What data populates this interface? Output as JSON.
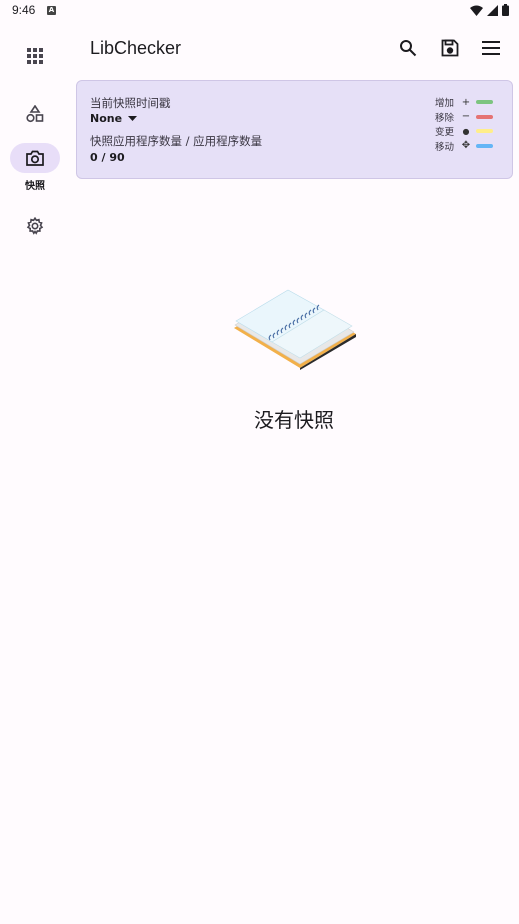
{
  "status_bar": {
    "time": "9:46",
    "a_badge": "A"
  },
  "app": {
    "title": "LibChecker"
  },
  "rail": {
    "items": [
      {
        "icon": "grid-apps-icon",
        "label": ""
      },
      {
        "icon": "shapes-icon",
        "label": ""
      },
      {
        "icon": "camera-icon",
        "label": "快照",
        "active": true
      },
      {
        "icon": "gear-icon",
        "label": ""
      }
    ]
  },
  "toolbar": {
    "actions": [
      "search-icon",
      "save-icon",
      "menu-icon"
    ]
  },
  "card": {
    "timestamp_label": "当前快照时间戳",
    "timestamp_value": "None",
    "count_label": "快照应用程序数量 / 应用程序数量",
    "count_value": "0 / 90",
    "legend": [
      {
        "label": "增加",
        "symbol": "+",
        "color": "#7cc47f"
      },
      {
        "label": "移除",
        "symbol": "−",
        "color": "#e57373"
      },
      {
        "label": "变更",
        "symbol": "●",
        "color": "#ffee8a"
      },
      {
        "label": "移动",
        "symbol": "✥",
        "color": "#64b5f6"
      }
    ]
  },
  "empty_state": {
    "text": "没有快照"
  },
  "colors": {
    "accent": "#e8def8",
    "card_bg": "#e6e0f7",
    "page_bg": "#fffbfe"
  }
}
